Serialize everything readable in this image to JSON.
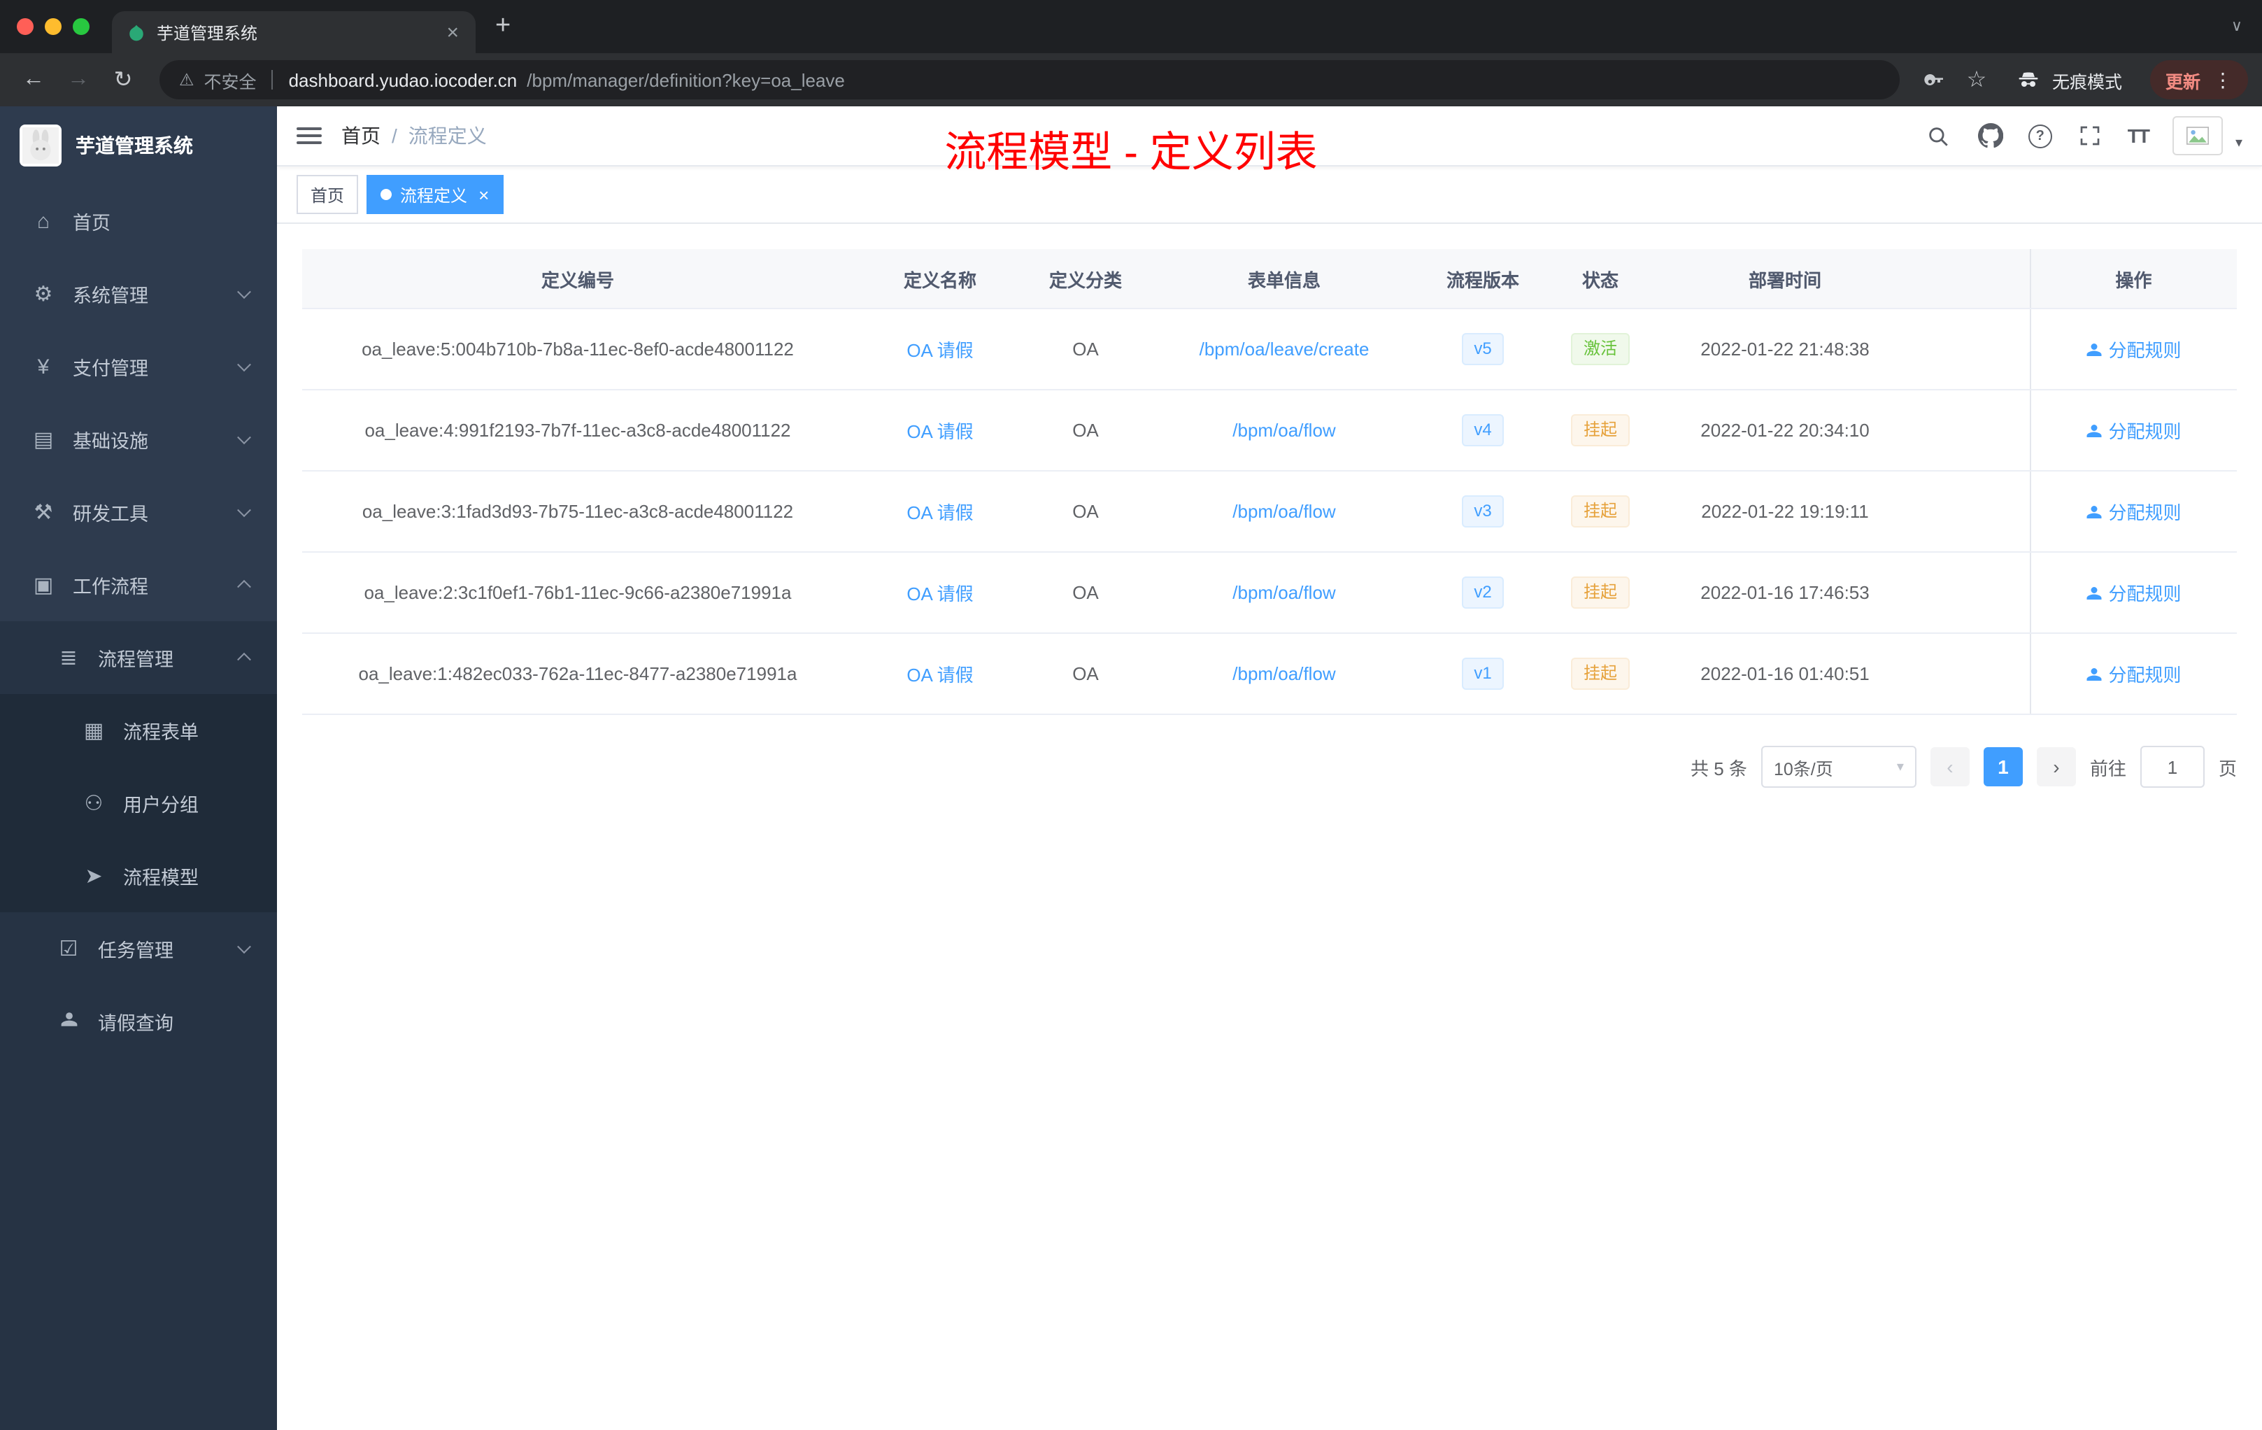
{
  "colors": {
    "accent": "#409EFF",
    "success": "#67C23A",
    "warning": "#E6A23C",
    "annotation": "#FF0000"
  },
  "icons": {
    "back": "←",
    "forward": "→",
    "reload": "↻",
    "warning": "⚠",
    "star": "☆",
    "plus": "+",
    "close": "×",
    "strip_chevron": "∨",
    "dots": "⋮",
    "caret_down": "▾",
    "question": "?",
    "font_size": "TT"
  },
  "browser": {
    "tab_title": "芋道管理系统",
    "security_warning": "不安全",
    "url_host": "dashboard.yudao.iocoder.cn",
    "url_rest": "/bpm/manager/definition?key=oa_leave",
    "incognito_label": "无痕模式",
    "update_label": "更新"
  },
  "sidebar": {
    "logo_title": "芋道管理系统",
    "items": [
      {
        "label": "首页"
      },
      {
        "label": "系统管理"
      },
      {
        "label": "支付管理"
      },
      {
        "label": "基础设施"
      },
      {
        "label": "研发工具"
      },
      {
        "label": "工作流程"
      }
    ],
    "submenu": {
      "process_mgmt": "流程管理",
      "children": [
        {
          "label": "流程表单"
        },
        {
          "label": "用户分组"
        },
        {
          "label": "流程模型"
        }
      ],
      "task_mgmt": "任务管理",
      "leave_query": "请假查询"
    }
  },
  "header": {
    "breadcrumb_home": "首页",
    "breadcrumb_current": "流程定义",
    "annotation": "流程模型 - 定义列表"
  },
  "tags": {
    "home": "首页",
    "current": "流程定义"
  },
  "table": {
    "headers": [
      "定义编号",
      "定义名称",
      "定义分类",
      "表单信息",
      "流程版本",
      "状态",
      "部署时间",
      "操作"
    ],
    "action_label": "分配规则",
    "rows": [
      {
        "id": "oa_leave:5:004b710b-7b8a-11ec-8ef0-acde48001122",
        "name": "OA 请假",
        "category": "OA",
        "form": "/bpm/oa/leave/create",
        "version": "v5",
        "status": "激活",
        "status_type": "success",
        "time": "2022-01-22 21:48:38"
      },
      {
        "id": "oa_leave:4:991f2193-7b7f-11ec-a3c8-acde48001122",
        "name": "OA 请假",
        "category": "OA",
        "form": "/bpm/oa/flow",
        "version": "v4",
        "status": "挂起",
        "status_type": "warning",
        "time": "2022-01-22 20:34:10"
      },
      {
        "id": "oa_leave:3:1fad3d93-7b75-11ec-a3c8-acde48001122",
        "name": "OA 请假",
        "category": "OA",
        "form": "/bpm/oa/flow",
        "version": "v3",
        "status": "挂起",
        "status_type": "warning",
        "time": "2022-01-22 19:19:11"
      },
      {
        "id": "oa_leave:2:3c1f0ef1-76b1-11ec-9c66-a2380e71991a",
        "name": "OA 请假",
        "category": "OA",
        "form": "/bpm/oa/flow",
        "version": "v2",
        "status": "挂起",
        "status_type": "warning",
        "time": "2022-01-16 17:46:53"
      },
      {
        "id": "oa_leave:1:482ec033-762a-11ec-8477-a2380e71991a",
        "name": "OA 请假",
        "category": "OA",
        "form": "/bpm/oa/flow",
        "version": "v1",
        "status": "挂起",
        "status_type": "warning",
        "time": "2022-01-16 01:40:51"
      }
    ]
  },
  "pagination": {
    "total": "共 5 条",
    "page_size": "10条/页",
    "current_page": "1",
    "goto_label": "前往",
    "goto_value": "1",
    "page_unit": "页"
  }
}
